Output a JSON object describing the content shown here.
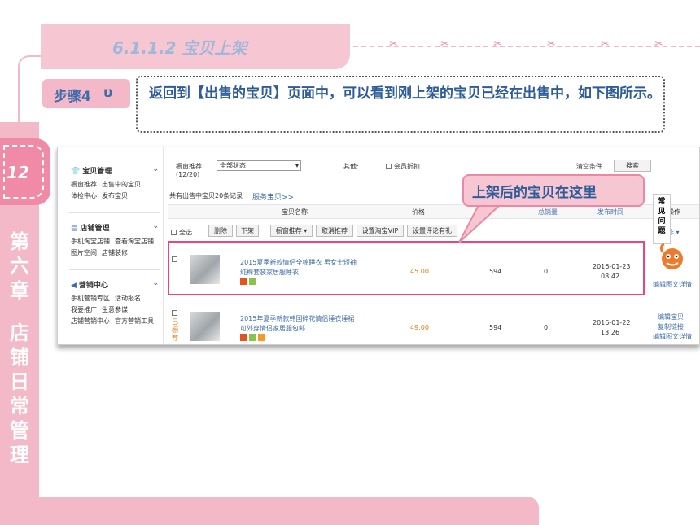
{
  "section": {
    "title": "6.1.1.2  宝贝上架"
  },
  "chapter": {
    "number": "12",
    "title": [
      "第",
      "六",
      "章",
      "",
      "店",
      "铺",
      "日",
      "常",
      "管",
      "理"
    ]
  },
  "step": {
    "label": "步骤4",
    "icon": "υ",
    "text": "返回到【出售的宝贝】页面中，可以看到刚上架的宝贝已经在出售中，如下图所示。"
  },
  "callout": {
    "text": "上架后的宝贝在这里"
  },
  "sidebar": {
    "groups": [
      {
        "title": "宝贝管理",
        "icon": "shirt-icon",
        "rows": [
          [
            "橱窗推荐",
            "出售中的宝贝"
          ],
          [
            "体检中心",
            "发布宝贝"
          ]
        ]
      },
      {
        "title": "店铺管理",
        "icon": "store-icon",
        "rows": [
          [
            "手机淘宝店铺",
            "查看淘宝店铺"
          ],
          [
            "图片空间",
            "店铺装修"
          ]
        ]
      },
      {
        "title": "营销中心",
        "icon": "megaphone-icon",
        "rows": [
          [
            "手机营销专区",
            "活动报名"
          ],
          [
            "我要推广",
            "生意参谋"
          ],
          [
            "店铺营销中心",
            "官方营销工具"
          ]
        ]
      }
    ]
  },
  "filters": {
    "window_label": "橱窗推荐:",
    "window_count": "(12/20)",
    "status_value": "全部状态",
    "other_label": "其他:",
    "member_discount": "会员折扣",
    "clear": "清空条件",
    "search": "搜索"
  },
  "summary": {
    "text": "共有出售中宝贝20条记录",
    "link": "服务宝贝>>"
  },
  "columns": {
    "name": "宝贝名称",
    "price": "价格",
    "sales": "总销量",
    "time": "发布时间",
    "ops": "操作"
  },
  "toolbar": {
    "select_all": "全选",
    "delete": "删除",
    "delist": "下架",
    "window_recommend": "橱窗推荐",
    "cancel_recommend": "取消推荐",
    "set_vip": "设置淘宝VIP",
    "set_review": "设置评论有礼",
    "more_ops": "操作"
  },
  "products": [
    {
      "title_line1": "2015夏季新款情侣全棉睡衣 男女士短袖",
      "title_line2": "纯棉套装家居服睡衣",
      "price": "45.00",
      "stock": "594",
      "sales": "0",
      "date": "2016-01-23",
      "time": "08:42",
      "ops": [
        "编辑图文详情"
      ]
    },
    {
      "title_line1": "2015年夏季新款韩国碎花情侣睡衣睡裙",
      "title_line2": "可外穿情侣家居服包邮",
      "price": "49.00",
      "stock": "594",
      "sales": "0",
      "date": "2016-01-22",
      "time": "13:26",
      "ops": [
        "编辑宝贝",
        "复制链接",
        "编辑图文详情"
      ],
      "side_tag": "已橱荐"
    }
  ],
  "faq": {
    "text": "常见问题"
  },
  "colors": {
    "pink": "#f3b9c8",
    "accent_pink": "#f08aa6",
    "frame": "#e9467a",
    "blue_text": "#2d5c99",
    "price": "#e47911"
  }
}
